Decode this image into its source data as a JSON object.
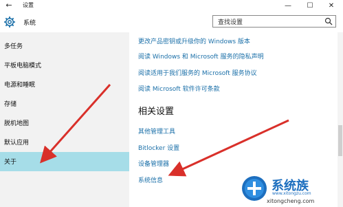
{
  "titlebar": {
    "back_symbol": "←",
    "title": "设置",
    "minimize_symbol": "—",
    "maximize_symbol": "☐",
    "close_symbol": "✕"
  },
  "header": {
    "title": "系统",
    "search_placeholder": "查找设置",
    "icon": "gear-icon"
  },
  "sidebar": {
    "items": [
      {
        "label": "多任务"
      },
      {
        "label": "平板电脑模式"
      },
      {
        "label": "电源和睡眠"
      },
      {
        "label": "存储"
      },
      {
        "label": "脱机地图"
      },
      {
        "label": "默认应用"
      },
      {
        "label": "关于",
        "active": true
      }
    ],
    "active_color": "#a6dde8"
  },
  "main": {
    "links_top": [
      "更改产品密钥或升级你的 Windows 版本",
      "阅读 Windows 和 Microsoft 服务的隐私声明",
      "阅读适用于我们服务的 Microsoft 服务协议",
      "阅读 Microsoft 软件许可条款"
    ],
    "related_title": "相关设置",
    "related_links": [
      "其他管理工具",
      "Bitlocker 设置",
      "设备管理器",
      "系统信息"
    ],
    "link_color": "#1a6fa8"
  },
  "watermark": {
    "brand": "系统族",
    "url": "www.xitongzu.com",
    "url2": "xitongcheng.com"
  },
  "annotation_color": "#d9302a"
}
